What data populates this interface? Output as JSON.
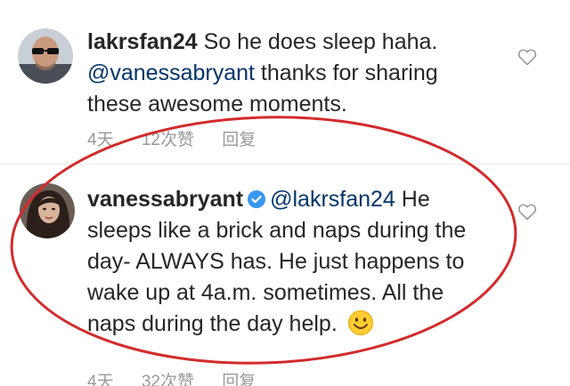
{
  "comments": [
    {
      "username": "lakrsfan24",
      "text_before": " So he does sleep haha. ",
      "mention": "@vanessabryant",
      "text_after": " thanks for sharing these awesome moments.",
      "time": "4天",
      "likes": "12次赞",
      "reply": "回复",
      "avatar_icon": "man-with-sunglasses-avatar",
      "like_icon": "heart-outline-icon"
    },
    {
      "username": "vanessabryant",
      "verified_icon": "verified-badge-icon",
      "mention": "@lakrsfan24",
      "text_after": " He sleeps like a brick and naps during the day- ALWAYS has. He just happens to wake up at 4a.m. sometimes. All the naps during the day help. ",
      "emoji": "smiling-face-emoji",
      "time": "4天",
      "likes": "32次赞",
      "reply": "回复",
      "avatar_icon": "woman-avatar",
      "like_icon": "heart-outline-icon"
    }
  ],
  "colors": {
    "annotation_circle": "#d32b2b",
    "verified_blue": "#3897f0",
    "mention_blue": "#003569",
    "meta_grey": "#999999"
  }
}
